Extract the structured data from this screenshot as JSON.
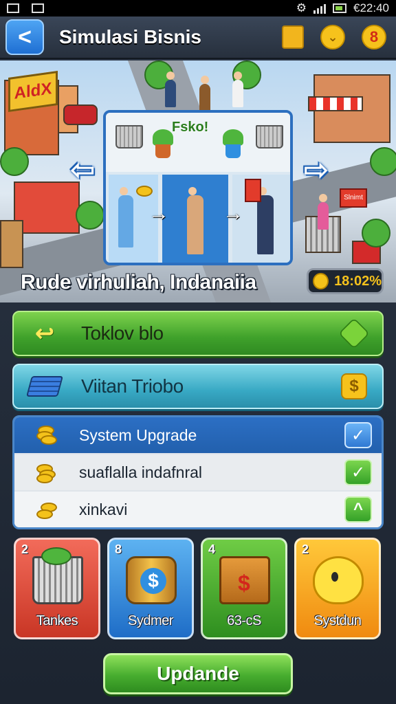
{
  "status_bar": {
    "time": "€22:40"
  },
  "header": {
    "back_label": "<",
    "title": "Simulasi Bisnis",
    "badge_chevron": "⌄",
    "badge_number": "8"
  },
  "scene": {
    "store_sign": "AldX",
    "shop_sign": "Slnimt",
    "panel_label": "Fsko!",
    "caption": "Rude virhuliah, Indanaiia",
    "timer": "18:02%",
    "nav_left": "⇦",
    "nav_right": "⇨"
  },
  "actions": {
    "primary_label": "Toklov blo",
    "secondary_label": "Viitan Triobo",
    "secondary_badge": "$"
  },
  "upgrade_list": [
    {
      "label": "System Upgrade",
      "check": "✓"
    },
    {
      "label": "suaflalla indafnral",
      "check": "✓"
    },
    {
      "label": "xinkavi",
      "check": "^"
    }
  ],
  "cards": [
    {
      "number": "2",
      "label": "Tankes"
    },
    {
      "number": "8",
      "label": "Sydmer"
    },
    {
      "number": "4",
      "label": "63-cS"
    },
    {
      "number": "2",
      "label": "Systdun"
    }
  ],
  "footer": {
    "update_label": "Updande"
  },
  "colors": {
    "accent_green": "#47ad2f",
    "accent_blue": "#2c6fc4",
    "accent_teal": "#38a9c4",
    "coin_gold": "#f4c21a"
  }
}
